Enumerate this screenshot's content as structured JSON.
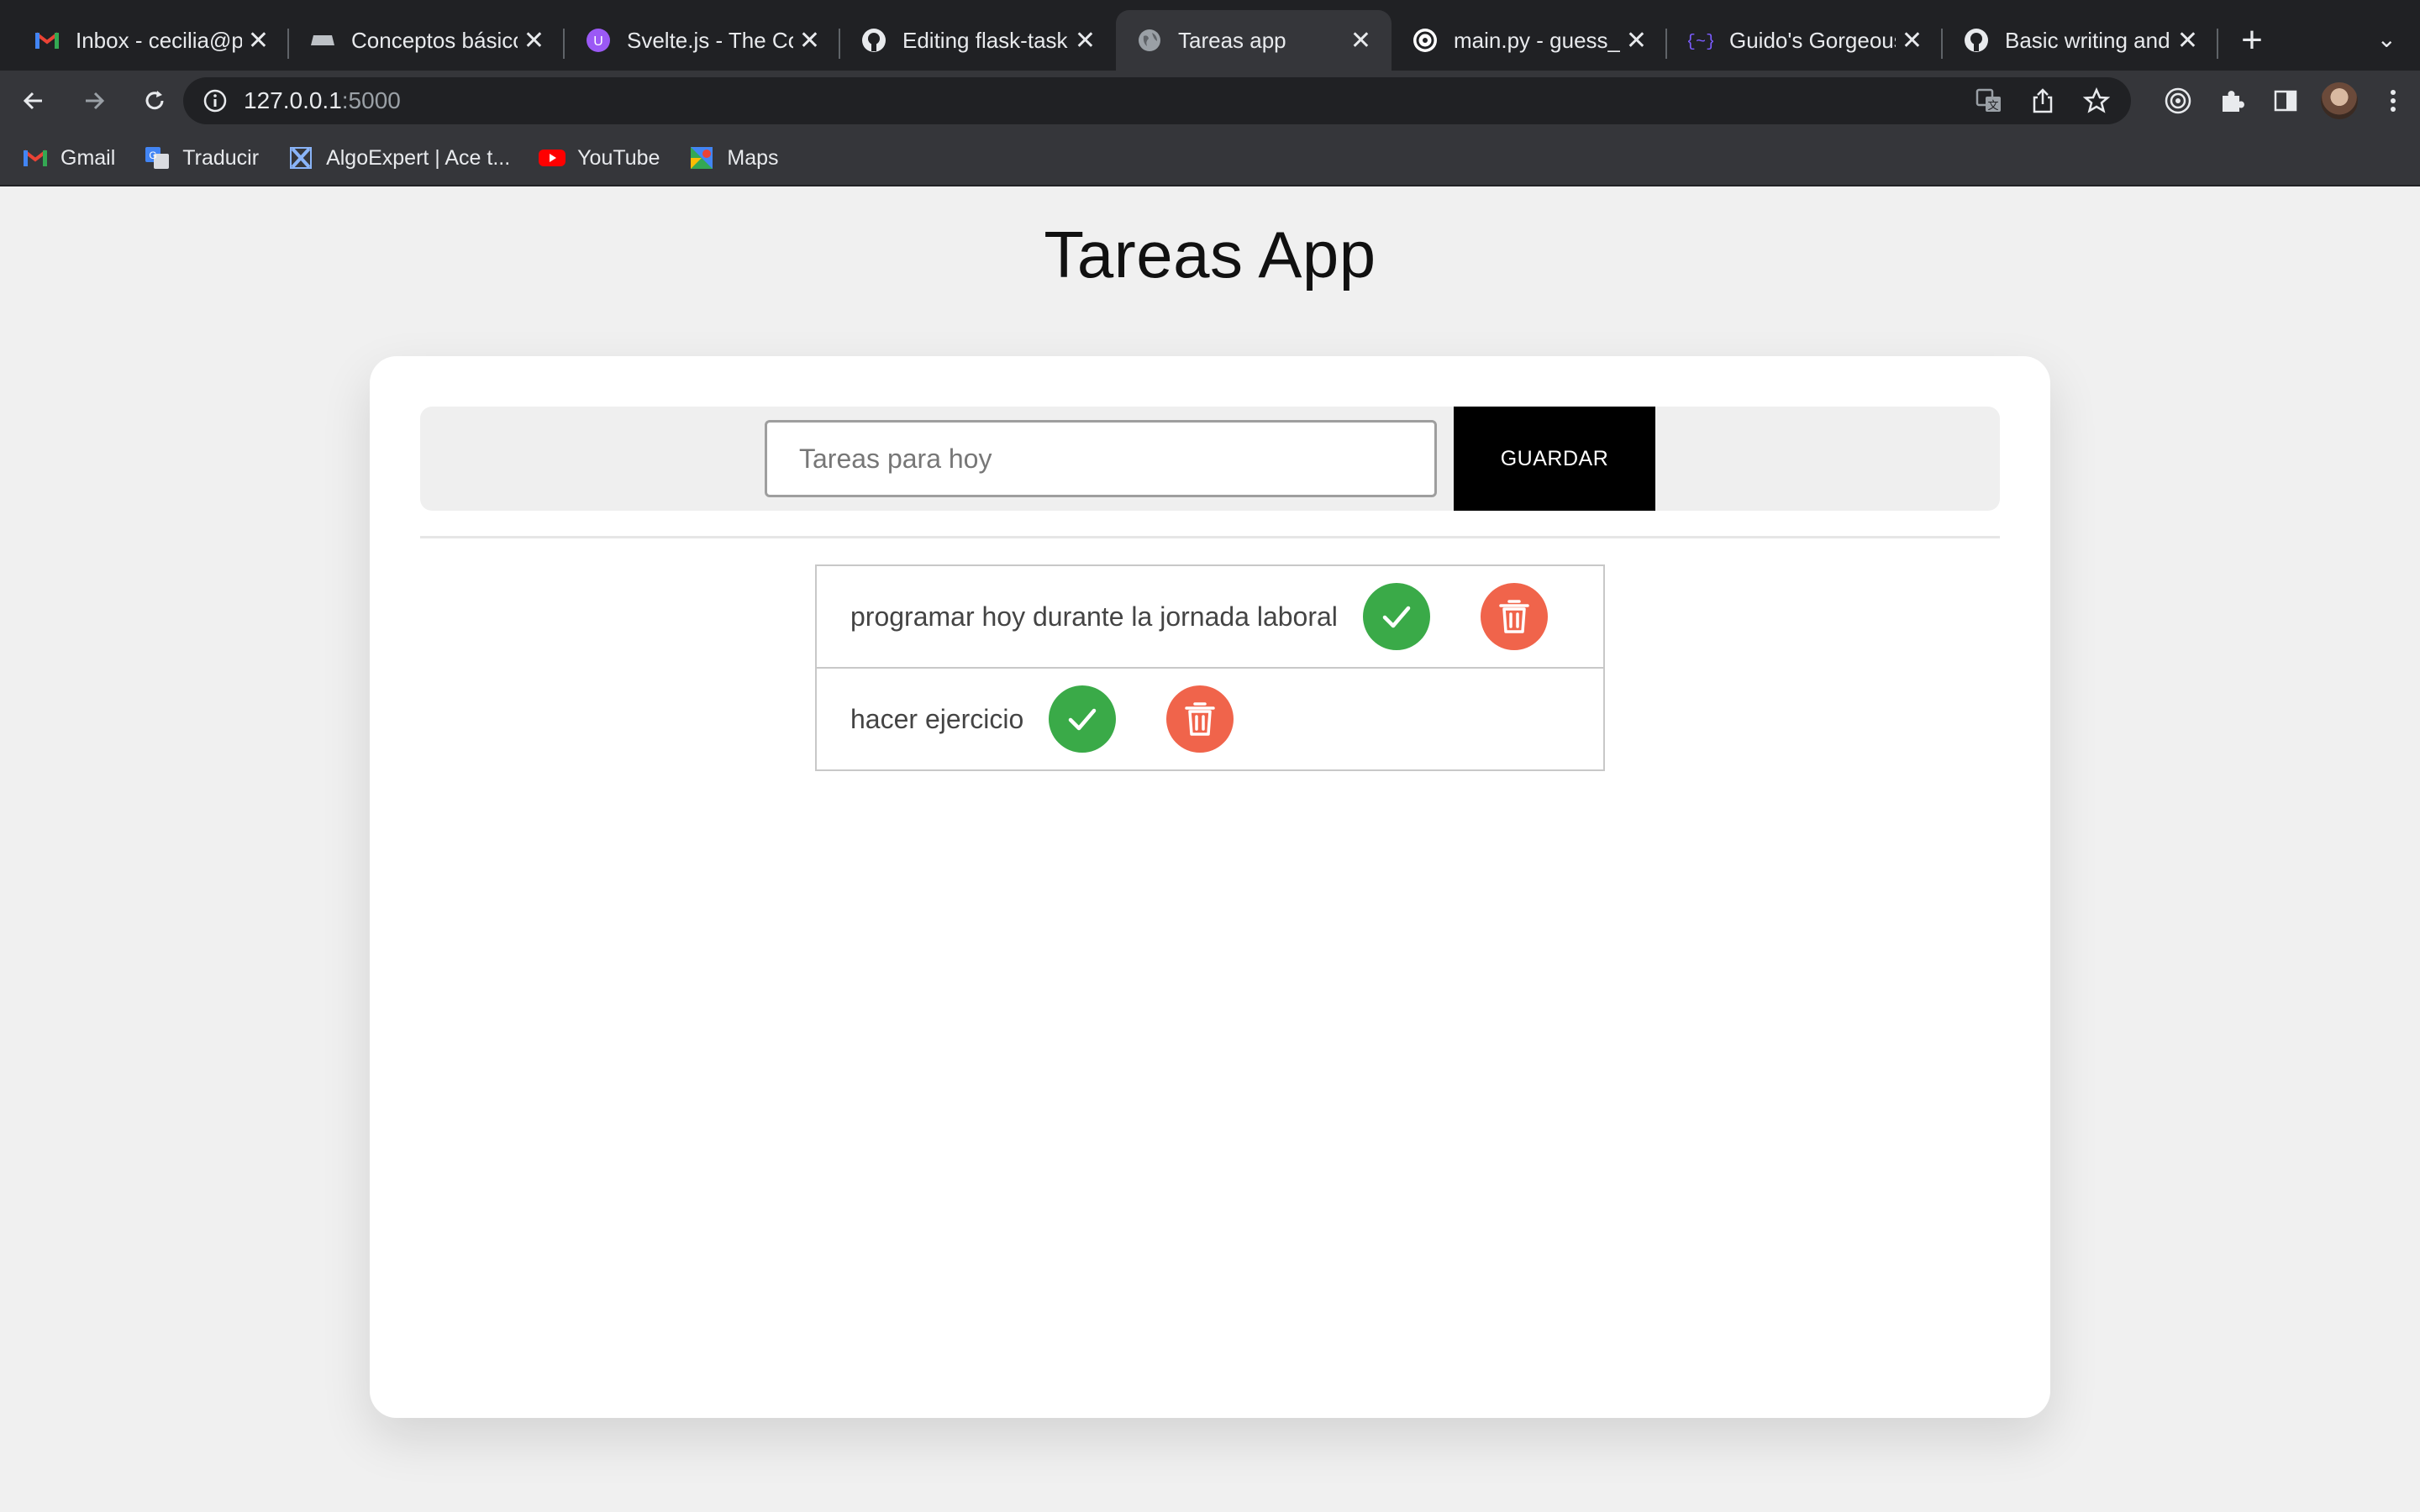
{
  "browser": {
    "tabs": [
      {
        "title": "Inbox - cecilia@p",
        "icon": "gmail-icon",
        "active": false
      },
      {
        "title": "Conceptos básico",
        "icon": "keyboard-icon",
        "active": false
      },
      {
        "title": "Svelte.js - The Co",
        "icon": "svelte-icon",
        "active": false
      },
      {
        "title": "Editing flask-task",
        "icon": "github-icon",
        "active": false
      },
      {
        "title": "Tareas app",
        "icon": "globe-icon",
        "active": true
      },
      {
        "title": "main.py - guess_",
        "icon": "replit-icon",
        "active": false
      },
      {
        "title": "Guido's Gorgeous",
        "icon": "bracket-icon",
        "active": false
      },
      {
        "title": "Basic writing and",
        "icon": "github-icon",
        "active": false
      }
    ],
    "new_tab_label": "+",
    "address": {
      "host": "127.0.0.1",
      "port": ":5000"
    },
    "bookmarks": [
      {
        "label": "Gmail",
        "icon": "gmail-icon"
      },
      {
        "label": "Traducir",
        "icon": "translate-icon"
      },
      {
        "label": "AlgoExpert | Ace t...",
        "icon": "algoexpert-icon"
      },
      {
        "label": "YouTube",
        "icon": "youtube-icon"
      },
      {
        "label": "Maps",
        "icon": "maps-icon"
      }
    ]
  },
  "app": {
    "title": "Tareas App",
    "form": {
      "placeholder": "Tareas para hoy",
      "value": "",
      "save_label": "GUARDAR"
    },
    "tasks": [
      {
        "text": "programar hoy durante la jornada laboral"
      },
      {
        "text": "hacer ejercicio"
      }
    ]
  },
  "colors": {
    "done": "#3aaa48",
    "delete": "#f0644b",
    "button": "#000000",
    "page_bg": "#f0f0f0"
  }
}
